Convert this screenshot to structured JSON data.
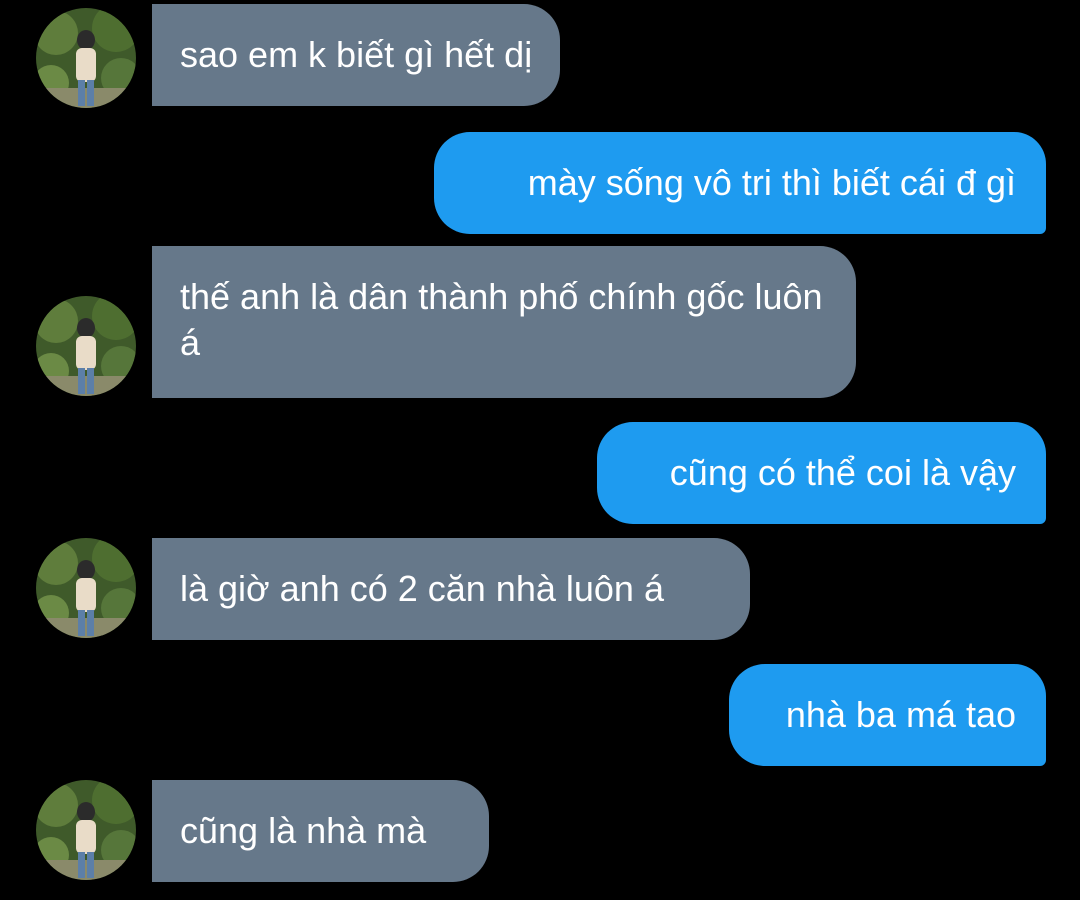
{
  "conversation": {
    "messages": [
      {
        "sender": "them",
        "text": "sao em k biết gì hết dị"
      },
      {
        "sender": "me",
        "text": "mày sống vô tri thì biết cái đ gì"
      },
      {
        "sender": "them",
        "text": "thế anh là dân thành phố chính gốc luôn á"
      },
      {
        "sender": "me",
        "text": "cũng có thể coi là vậy"
      },
      {
        "sender": "them",
        "text": "là giờ anh có 2 căn nhà luôn á"
      },
      {
        "sender": "me",
        "text": "nhà ba má tao"
      },
      {
        "sender": "them",
        "text": "cũng là nhà mà"
      }
    ]
  },
  "colors": {
    "background": "#000000",
    "incoming_bubble": "#66788a",
    "outgoing_bubble": "#1e9bf0",
    "text": "#ffffff"
  },
  "icons": {
    "avatar": "contact-avatar-photo"
  }
}
